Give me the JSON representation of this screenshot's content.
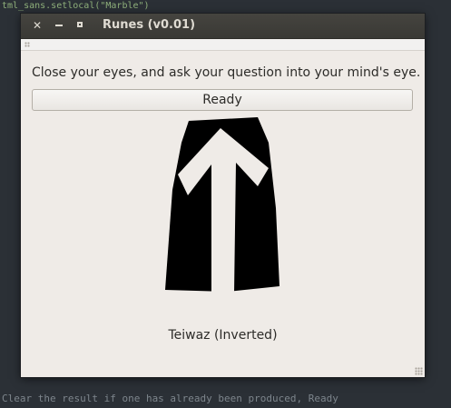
{
  "window": {
    "title": "Runes (v0.01)"
  },
  "prompt": {
    "text": "Close your eyes, and ask your question into your mind's eye."
  },
  "ready_button": {
    "label": "Ready"
  },
  "result": {
    "rune_name": "Teiwaz (Inverted)",
    "rune_icon": "teiwaz-rune-inverted"
  },
  "background_editor": {
    "top_line_fragment": "tml_sans.setlocal(\"Marble\")",
    "bottom_line_fragment": "Clear the result if one has already been produced, Ready"
  },
  "colors": {
    "window_bg": "#efebe7",
    "titlebar_bg": "#3f3e3a",
    "rune_stone": "#000000",
    "rune_symbol": "#efebe7",
    "desktop_bg": "#2b3036"
  }
}
